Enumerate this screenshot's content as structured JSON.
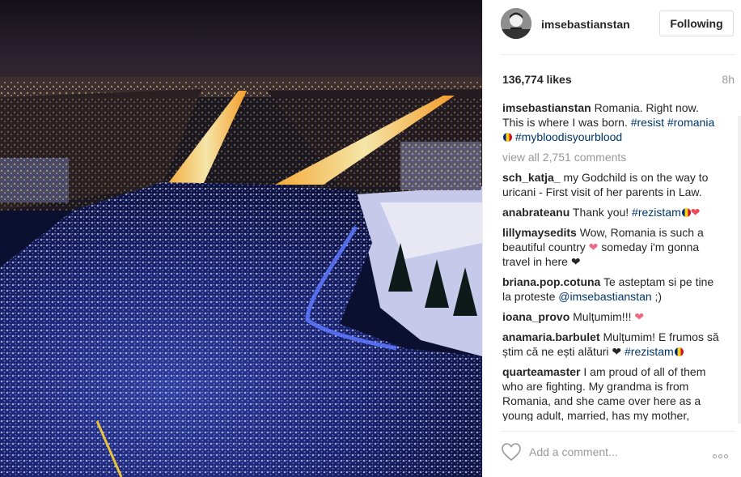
{
  "post": {
    "username": "imsebastianstan",
    "follow_label": "Following",
    "likes": "136,774 likes",
    "time": "8h",
    "caption": {
      "username": "imsebastianstan",
      "text": "Romania. Right now. This is where I was born.",
      "tags": [
        "#resist",
        "#romania",
        "#mybloodisyourblood"
      ]
    },
    "view_all": "view all 2,751 comments",
    "comments": [
      {
        "user": "sch_katja_",
        "text": "my Godchild is on the way to uricani - First visit of her parents in Law."
      },
      {
        "user": "anabrateanu",
        "text": "Thank you!",
        "tag": "#rezistam"
      },
      {
        "user": "lillymaysedits",
        "text": "Wow, Romania is such a beautiful country",
        "text2": "someday i'm gonna travel in here"
      },
      {
        "user": "briana.pop.cotuna",
        "text": "Te asteptam si pe tine la proteste",
        "mention": "@imsebastianstan",
        "text2": ";)"
      },
      {
        "user": "ioana_provo",
        "text": "Mulțumim!!!"
      },
      {
        "user": "anamaria.barbulet",
        "text": "Mulțumim! E frumos să știm că ne ești alături",
        "tag": "#rezistam"
      },
      {
        "user": "quarteamaster",
        "text": "I am proud of all of them who are fighting. My grandma is from Romania, and she came over here as a young adult, married, has my mother,"
      }
    ],
    "comment_placeholder": "Add a comment...",
    "icons": {
      "like": "heart-outline-icon",
      "more": "more-options-icon",
      "flag": "romania-flag-icon"
    }
  },
  "colors": {
    "link": "#003569",
    "muted": "#999999",
    "heart": "#ed4956"
  }
}
